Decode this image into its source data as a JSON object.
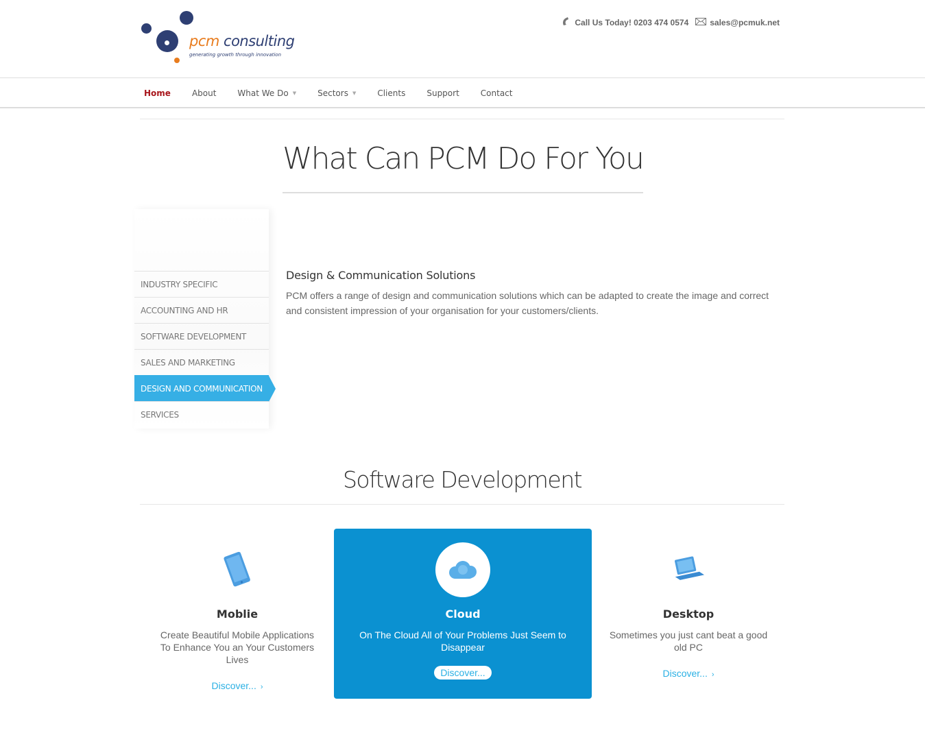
{
  "header": {
    "brand_a": "pcm",
    "brand_b": " consulting",
    "tagline": "generating growth through innovation",
    "phone_label": "Call Us Today! 0203 474 0574",
    "email_label": "sales@pcmuk.net"
  },
  "nav": {
    "items": [
      {
        "label": "Home",
        "active": true
      },
      {
        "label": "About"
      },
      {
        "label": "What We Do",
        "dropdown": true
      },
      {
        "label": "Sectors",
        "dropdown": true
      },
      {
        "label": "Clients"
      },
      {
        "label": "Support"
      },
      {
        "label": "Contact"
      }
    ]
  },
  "hero": {
    "title": "What Can PCM Do For You"
  },
  "tabs": {
    "items": [
      {
        "label": "INDUSTRY SPECIFIC"
      },
      {
        "label": "ACCOUNTING AND HR"
      },
      {
        "label": "SOFTWARE DEVELOPMENT"
      },
      {
        "label": "SALES AND MARKETING"
      },
      {
        "label": "DESIGN AND COMMUNICATION",
        "active": true
      },
      {
        "label": "SERVICES"
      }
    ]
  },
  "detail": {
    "title": "Design & Communication Solutions",
    "text": "PCM offers a range of design and communication solutions which can be adapted to create the image and correct and consistent impression of your organisation for your customers/clients."
  },
  "software": {
    "title": "Software Development",
    "cards": [
      {
        "title": "Moblie",
        "text": "Create Beautiful Mobile Applications To Enhance You an Your Customers Lives",
        "link": "Discover...",
        "icon": "tablet-icon"
      },
      {
        "title": "Cloud",
        "text": "On The Cloud All of Your Problems Just Seem to Disappear",
        "link": "Discover...",
        "icon": "cloud-icon"
      },
      {
        "title": "Desktop",
        "text": "Sometimes you just cant beat a good old PC",
        "link": "Discover...",
        "icon": "laptop-icon"
      }
    ]
  },
  "colors": {
    "accent_blue": "#36afe5",
    "card_blue": "#0b91d1",
    "brand_orange": "#e87c1e",
    "brand_navy": "#2e3f73",
    "nav_active": "#a8161c"
  }
}
